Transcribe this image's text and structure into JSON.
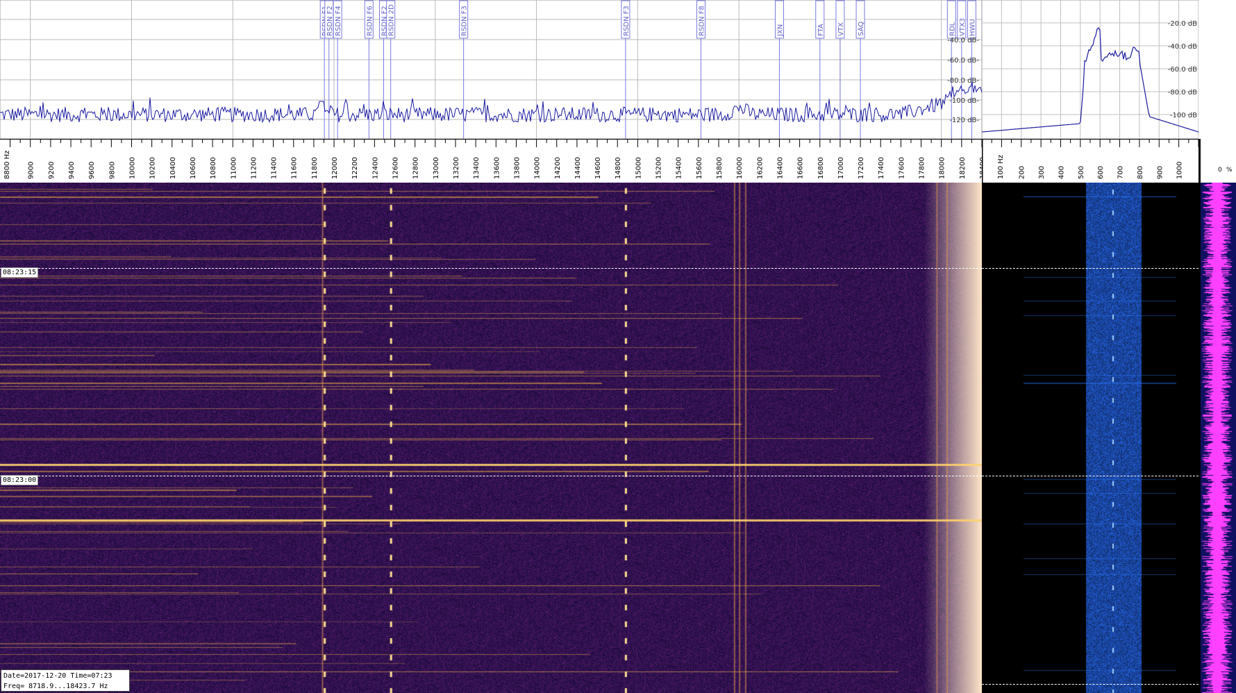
{
  "main_spectrum": {
    "freq_range_hz": [
      8700,
      18400
    ],
    "db_range": [
      -140,
      0
    ],
    "db_labels": [
      "-40.0 dB-",
      "-60.0 dB-",
      "-80.0 dB-",
      "-100 dB-",
      "-120 dB-"
    ],
    "markers": [
      {
        "label": "RSDN F1",
        "freq": 11905
      },
      {
        "label": "RSDN F2",
        "freq": 11950
      },
      {
        "label": "RSDN F4",
        "freq": 12035
      },
      {
        "label": "RSDN F6",
        "freq": 12345
      },
      {
        "label": "RSDN F2",
        "freq": 12490
      },
      {
        "label": "RSDN 2D",
        "freq": 12560
      },
      {
        "label": "RSDN F3",
        "freq": 13280
      },
      {
        "label": "RSDN F3",
        "freq": 14880
      },
      {
        "label": "RSDN F8",
        "freq": 15625
      },
      {
        "label": "JXN",
        "freq": 16400
      },
      {
        "label": "FTA",
        "freq": 16800
      },
      {
        "label": "VTX",
        "freq": 17000
      },
      {
        "label": "SAQ",
        "freq": 17200
      },
      {
        "label": "RDL",
        "freq": 18100
      },
      {
        "label": "VTX3",
        "freq": 18200
      },
      {
        "label": "HWU",
        "freq": 18300
      }
    ]
  },
  "main_scale": {
    "unit_label": "8800 Hz",
    "ticks": [
      "9000",
      "9200",
      "9400",
      "9600",
      "9800",
      "10000",
      "10200",
      "10400",
      "10600",
      "10800",
      "11000",
      "11200",
      "11400",
      "11600",
      "11800",
      "12000",
      "12200",
      "12400",
      "12600",
      "12800",
      "13000",
      "13200",
      "13400",
      "13600",
      "13800",
      "14000",
      "14200",
      "14400",
      "14600",
      "14800",
      "15000",
      "15200",
      "15400",
      "15600",
      "15800",
      "16000",
      "16200",
      "16400",
      "16600",
      "16800",
      "17000",
      "17200",
      "17400",
      "17600",
      "17800",
      "18000",
      "18200",
      "18400"
    ]
  },
  "side_spectrum": {
    "db_labels": [
      "-20.0 dB",
      "-40.0 dB",
      "-60.0 dB",
      "-80.0 dB",
      "-100 dB"
    ]
  },
  "side_scale": {
    "unit_label": "100 Hz",
    "ticks": [
      "200",
      "300",
      "400",
      "500",
      "600",
      "700",
      "800",
      "900",
      "1000"
    ]
  },
  "level_header": {
    "zero_label": "0",
    "percent_label": "%"
  },
  "waterfall": {
    "time_marks": [
      {
        "label": "08:23:15"
      },
      {
        "label": "08:23:00"
      }
    ]
  },
  "info": {
    "line1": "Date=2017-12-20 Time=07:23",
    "line2": "Freq= 8718.9...18423.7 Hz"
  },
  "colors": {
    "spectrum_trace": "#1a1aa0",
    "marker_line": "#7a7adf",
    "waterfall_bg": "#10083a",
    "signal_hot": "#ffd070",
    "side_signal": "#2a6aff",
    "level_trace": "#ff40ff"
  }
}
